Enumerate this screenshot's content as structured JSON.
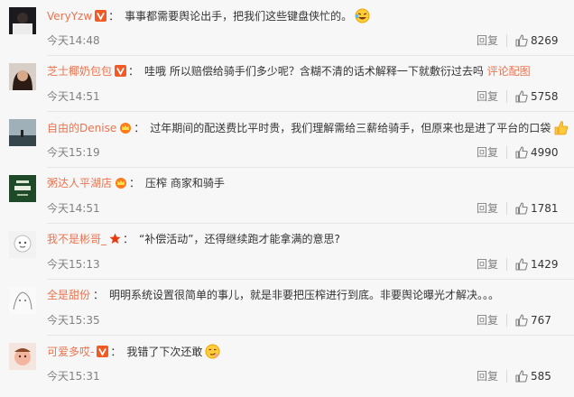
{
  "comments": [
    {
      "user": "VeryYzw",
      "separator": "：",
      "text": "事事都需要舆论出手，把我们这些键盘侠忙的。",
      "link": "",
      "time": "今天14:48",
      "reply": "回复",
      "likes": "8269",
      "emoji": "laughing-tears-emoji",
      "badge": "vip-v-icon"
    },
    {
      "user": "芝士椰奶包包",
      "separator": "：",
      "text": "哇哦 所以赔偿给骑手们多少呢？含糊不清的话术解释一下就敷衍过去吗 ",
      "link": "评论配图",
      "time": "今天14:51",
      "reply": "回复",
      "likes": "5758",
      "emoji": "",
      "badge": "vip-v-icon"
    },
    {
      "user": "自由的Denise",
      "separator": "：",
      "text": "过年期间的配送费比平时贵，我们理解需给三薪给骑手，但原来也是进了平台的口袋",
      "link": "",
      "time": "今天15:19",
      "reply": "回复",
      "likes": "4990",
      "emoji": "thumbs-up-emoji",
      "badge": "crown-icon"
    },
    {
      "user": "粥达人平湖店",
      "separator": "：",
      "text": "压榨 商家和骑手",
      "link": "",
      "time": "今天14:51",
      "reply": "回复",
      "likes": "1781",
      "emoji": "",
      "badge": "crown-icon"
    },
    {
      "user": "我不是彬哥_",
      "separator": "：",
      "text": "“补偿活动”，还得继续跑才能拿满的意思?",
      "link": "",
      "time": "今天15:13",
      "reply": "回复",
      "likes": "1429",
      "emoji": "",
      "badge": "star-icon"
    },
    {
      "user": "全是甜份",
      "separator": "：",
      "text": "明明系统设置很简单的事儿，就是非要把压榨进行到底。非要舆论曝光才解决。。。",
      "link": "",
      "time": "今天15:35",
      "reply": "回复",
      "likes": "767",
      "emoji": "",
      "badge": ""
    },
    {
      "user": "可爱多哎-",
      "separator": "：",
      "text": "我错了下次还敢",
      "link": "",
      "time": "今天15:31",
      "reply": "回复",
      "likes": "585",
      "emoji": "smirk-emoji",
      "badge": "vip-v-icon"
    }
  ],
  "colors": {
    "username": "#eb7350",
    "meta": "#808080",
    "vip": "#f15a22",
    "crown": "#ffb300"
  }
}
